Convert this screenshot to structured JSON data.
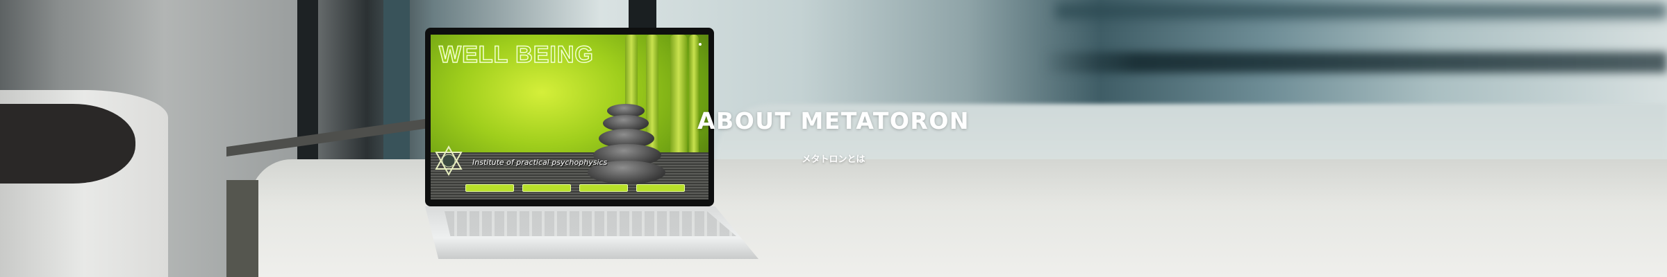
{
  "hero": {
    "title": "ABOUT METATORON",
    "subtitle": "メタトロンとは"
  },
  "laptop_screen": {
    "title": "WELL BEING",
    "subtitle": "Institute of practical psychophysics",
    "buttons": [
      "",
      "",
      "",
      ""
    ],
    "icon": "star-of-david-icon"
  },
  "colors": {
    "text": "#ffffff",
    "screen_green": "#9fce1c",
    "button_green": "#b8e02a"
  }
}
